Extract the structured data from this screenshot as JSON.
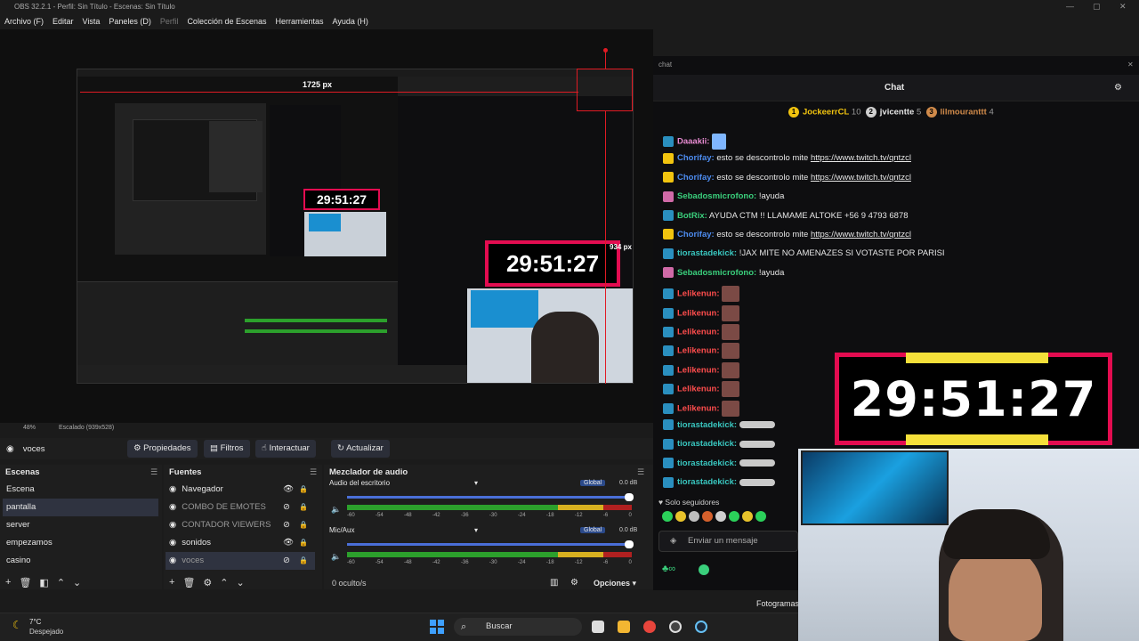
{
  "window": {
    "title": "OBS 32.2.1 - Perfil: Sin Título - Escenas: Sin Título"
  },
  "menu": [
    {
      "label": "Archivo (F)",
      "enabled": true
    },
    {
      "label": "Editar",
      "enabled": true
    },
    {
      "label": "Vista",
      "enabled": true
    },
    {
      "label": "Paneles (D)",
      "enabled": true
    },
    {
      "label": "Perfil",
      "enabled": false
    },
    {
      "label": "Colección de Escenas",
      "enabled": true
    },
    {
      "label": "Herramientas",
      "enabled": true
    },
    {
      "label": "Ayuda (H)",
      "enabled": true
    }
  ],
  "preview": {
    "size_label_1": "1725 px",
    "size_label_2": "934 px",
    "zoom": "48%",
    "scaled": "Escalado (939x528)",
    "timer": "29:51:27"
  },
  "chat": {
    "dock_title": "chat",
    "title": "Chat",
    "leaders": [
      {
        "rank": "1",
        "name": "JockeerrCL",
        "count": "10",
        "color": "#f2c40f"
      },
      {
        "rank": "2",
        "name": "jvicentte",
        "count": "5",
        "color": "#cfcfcf"
      },
      {
        "rank": "3",
        "name": "lilmouranttt",
        "count": "4",
        "color": "#d08a4a"
      }
    ],
    "messages": [
      {
        "user": "Daaakii:",
        "cls": "u-pink",
        "badge": "b-blue",
        "text": "",
        "emote": "hand"
      },
      {
        "user": "Chorifay:",
        "cls": "u-blue",
        "badge": "b-yel",
        "text": "esto se descontrolo mite ",
        "link": "https://www.twitch.tv/qntzcl"
      },
      {
        "user": "Chorifay:",
        "cls": "u-blue",
        "badge": "b-yel",
        "text": "esto se descontrolo mite ",
        "link": "https://www.twitch.tv/qntzcl"
      },
      {
        "user": "Sebadosmicrofono:",
        "cls": "u-green",
        "badge": "b-pink",
        "text": "!ayuda"
      },
      {
        "user": "BotRix:",
        "cls": "u-green",
        "badge": "b-blue",
        "text": "AYUDA CTM !! LLAMAME ALTOKE +56 9 4793 6878"
      },
      {
        "user": "Chorifay:",
        "cls": "u-blue",
        "badge": "b-yel",
        "text": "esto se descontrolo mite ",
        "link": "https://www.twitch.tv/qntzcl"
      },
      {
        "user": "tiorastadekick:",
        "cls": "u-teal",
        "badge": "b-blue",
        "text": "!JAX MITE NO AMENAZES SI VOTASTE POR PARISI"
      },
      {
        "user": "Sebadosmicrofono:",
        "cls": "u-green",
        "badge": "b-pink",
        "text": "!ayuda"
      },
      {
        "user": "Lelikenun:",
        "cls": "u-red",
        "badge": "b-blue",
        "text": "",
        "emote": "face"
      },
      {
        "user": "Lelikenun:",
        "cls": "u-red",
        "badge": "b-blue",
        "text": "",
        "emote": "face"
      },
      {
        "user": "Lelikenun:",
        "cls": "u-red",
        "badge": "b-blue",
        "text": "",
        "emote": "face"
      },
      {
        "user": "Lelikenun:",
        "cls": "u-red",
        "badge": "b-blue",
        "text": "",
        "emote": "face"
      },
      {
        "user": "Lelikenun:",
        "cls": "u-red",
        "badge": "b-blue",
        "text": "",
        "emote": "face"
      },
      {
        "user": "Lelikenun:",
        "cls": "u-red",
        "badge": "b-blue",
        "text": "",
        "emote": "face"
      },
      {
        "user": "Lelikenun:",
        "cls": "u-red",
        "badge": "b-blue",
        "text": "",
        "emote": "face"
      },
      {
        "user": "tiorastadekick:",
        "cls": "u-teal",
        "badge": "b-blue",
        "text": "",
        "emote": "shark"
      },
      {
        "user": "tiorastadekick:",
        "cls": "u-teal",
        "badge": "b-blue",
        "text": "",
        "emote": "shark"
      },
      {
        "user": "tiorastadekick:",
        "cls": "u-teal",
        "badge": "b-blue",
        "text": "",
        "emote": "shark"
      },
      {
        "user": "tiorastadekick:",
        "cls": "u-teal",
        "badge": "b-blue",
        "text": "",
        "emote": "shark"
      }
    ],
    "followers_only": "Solo seguidores",
    "input_placeholder": "Enviar un mensaje",
    "frames_label": "Fotogramas"
  },
  "toolbar": {
    "source_name": "voces",
    "properties": "Propiedades",
    "filters": "Filtros",
    "interact": "Interactuar",
    "refresh": "Actualizar"
  },
  "scenes": {
    "title": "Escenas",
    "items": [
      "Escena",
      "pantalla",
      "server",
      "empezamos",
      "casino"
    ],
    "selected": 1
  },
  "sources": {
    "title": "Fuentes",
    "items": [
      {
        "name": "Navegador",
        "visible": true
      },
      {
        "name": "COMBO DE EMOTES",
        "visible": false
      },
      {
        "name": "CONTADOR VIEWERS",
        "visible": false
      },
      {
        "name": "sonidos",
        "visible": true
      },
      {
        "name": "voces",
        "visible": false
      }
    ]
  },
  "mixer": {
    "title": "Mezclador de audio",
    "channels": [
      {
        "name": "Audio del escritorio",
        "badge": "Global",
        "db": "0.0 dB"
      },
      {
        "name": "Mic/Aux",
        "badge": "Global",
        "db": "0.0 dB"
      }
    ],
    "scale": [
      "-60",
      "-54",
      "-48",
      "-42",
      "-36",
      "-30",
      "-24",
      "-18",
      "-12",
      "-6",
      "0"
    ],
    "hidden": "0 oculto/s",
    "options": "Opciones"
  },
  "taskbar": {
    "temp": "7°C",
    "weather": "Despejado",
    "search": "Buscar"
  },
  "colors": {
    "accent": "#e30c50",
    "timer_bar": "#f5e03a",
    "red_guide": "#e01b24"
  }
}
